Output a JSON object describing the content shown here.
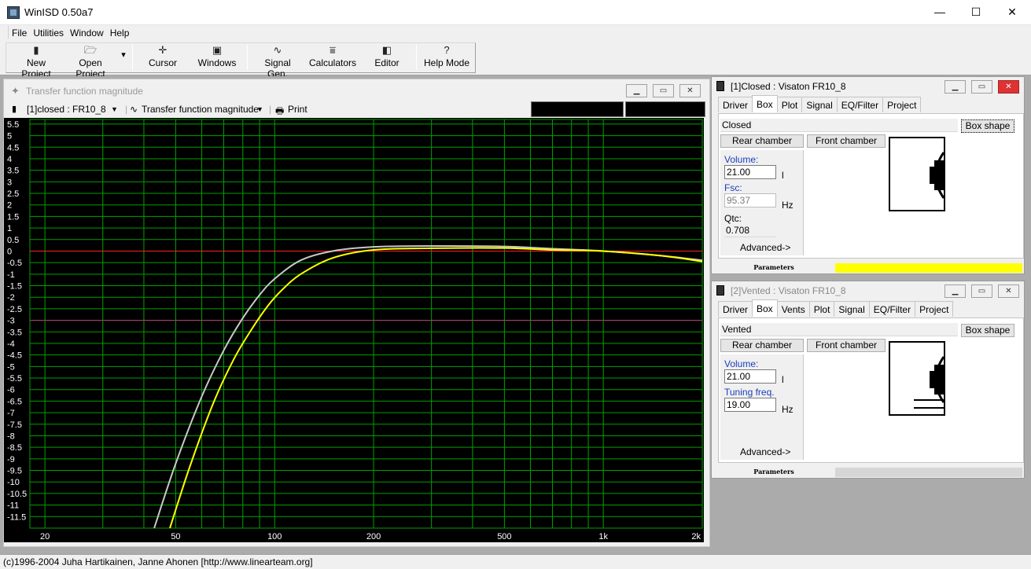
{
  "window": {
    "title": "WinISD 0.50a7",
    "minimize": "—",
    "maximize": "☐",
    "close": "✕"
  },
  "menu": [
    "File",
    "Utilities",
    "Window",
    "Help"
  ],
  "toolbar": {
    "buttons": [
      {
        "label": "New Project",
        "icon": "new-project-icon"
      },
      {
        "label": "Open Project",
        "icon": "open-folder-icon"
      },
      {
        "label": "Cursor",
        "icon": "cursor-icon"
      },
      {
        "label": "Windows",
        "icon": "windows-icon"
      },
      {
        "label": "Signal Gen.",
        "icon": "signal-wave-icon"
      },
      {
        "label": "Calculators",
        "icon": "calculator-icon"
      },
      {
        "label": "Editor",
        "icon": "editor-icon"
      },
      {
        "label": "Help Mode",
        "icon": "question-icon"
      }
    ],
    "dropdown_glyph": "▾"
  },
  "plot_window": {
    "title": "Transfer function magnitude",
    "project_select": "[1]closed : FR10_8",
    "graph_select": "Transfer function magnitude",
    "print_label": "Print"
  },
  "chart_data": {
    "type": "line",
    "x_scale": "log",
    "xlim": [
      18,
      2000
    ],
    "ylim": [
      -12,
      5.7
    ],
    "x_tick_labels": [
      {
        "x": 20,
        "label": "20"
      },
      {
        "x": 50,
        "label": "50"
      },
      {
        "x": 100,
        "label": "100"
      },
      {
        "x": 200,
        "label": "200"
      },
      {
        "x": 500,
        "label": "500"
      },
      {
        "x": 1000,
        "label": "1k"
      },
      {
        "x": 2000,
        "label": "2k"
      }
    ],
    "y_ticks": [
      5.5,
      5,
      4.5,
      4,
      3.5,
      3,
      2.5,
      2,
      1.5,
      1,
      0.5,
      0,
      -0.5,
      -1,
      -1.5,
      -2,
      -2.5,
      -3,
      -3.5,
      -4,
      -4.5,
      -5,
      -5.5,
      -6,
      -6.5,
      -7,
      -7.5,
      -8,
      -8.5,
      -9,
      -9.5,
      -10,
      -10.5,
      -11,
      -11.5
    ],
    "reference_lines": [
      {
        "y": 0,
        "color": "#ff2020"
      },
      {
        "y": -3,
        "color": "#c0307a"
      }
    ],
    "grid": true,
    "background": "#000000",
    "grid_color": "#00a000",
    "series": [
      {
        "color": "#c8c8c8",
        "x": [
          43,
          50,
          60,
          70,
          80,
          90,
          100,
          120,
          150,
          200,
          300,
          500,
          700,
          1000,
          1500,
          2000
        ],
        "y": [
          -12.0,
          -9.2,
          -6.3,
          -4.3,
          -2.9,
          -1.9,
          -1.2,
          -0.4,
          0.0,
          0.18,
          0.22,
          0.2,
          0.1,
          0.0,
          -0.2,
          -0.4
        ]
      },
      {
        "color": "#ffff00",
        "x": [
          48,
          55,
          65,
          75,
          85,
          95,
          105,
          120,
          150,
          200,
          300,
          500,
          700,
          1000,
          1500,
          2000
        ],
        "y": [
          -12.0,
          -9.4,
          -6.6,
          -4.7,
          -3.4,
          -2.4,
          -1.7,
          -1.0,
          -0.3,
          0.05,
          0.12,
          0.13,
          0.05,
          0.0,
          -0.2,
          -0.45
        ]
      }
    ]
  },
  "closed_window": {
    "title": "[1]Closed : Visaton FR10_8",
    "tabs": [
      "Driver",
      "Box",
      "Plot",
      "Signal",
      "EQ/Filter",
      "Project"
    ],
    "active_tab": "Box",
    "box_type": "Closed",
    "box_shape_button": "Box shape",
    "rear_chamber": "Rear chamber",
    "front_chamber": "Front chamber",
    "volume_label": "Volume:",
    "volume_value": "21.00",
    "volume_unit": "l",
    "fsc_label": "Fsc:",
    "fsc_value": "95.37",
    "fsc_unit": "Hz",
    "qtc_label": "Qtc:",
    "qtc_value": "0.708",
    "advanced": "Advanced->",
    "parameters": "Parameters",
    "strip_color": "#ffff00"
  },
  "vented_window": {
    "title": "[2]Vented : Visaton FR10_8",
    "tabs": [
      "Driver",
      "Box",
      "Vents",
      "Plot",
      "Signal",
      "EQ/Filter",
      "Project"
    ],
    "active_tab": "Box",
    "box_type": "Vented",
    "box_shape_button": "Box shape",
    "rear_chamber": "Rear chamber",
    "front_chamber": "Front chamber",
    "volume_label": "Volume:",
    "volume_value": "21.00",
    "volume_unit": "l",
    "tuning_label": "Tuning freq.",
    "tuning_value": "19.00",
    "tuning_unit": "Hz",
    "advanced": "Advanced->",
    "parameters": "Parameters"
  },
  "status": "(c)1996-2004 Juha Hartikainen, Janne Ahonen [http://www.linearteam.org]"
}
